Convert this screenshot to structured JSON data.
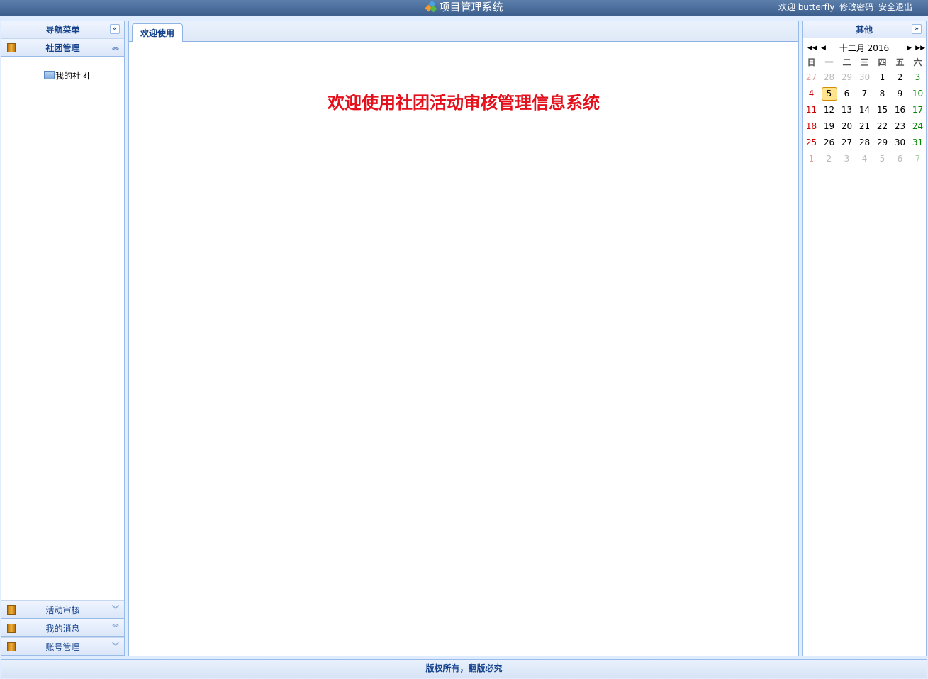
{
  "header": {
    "app_title": "项目管理系统",
    "welcome_user": "欢迎 butterfly",
    "change_password": "修改密码",
    "logout": "安全退出"
  },
  "west": {
    "title": "导航菜单",
    "collapse_icon": "double-chevron-left-icon",
    "active_section": {
      "label": "社团管理",
      "items": [
        {
          "label": "我的社团",
          "icon": "folder-icon"
        }
      ]
    },
    "sections": [
      {
        "label": "活动审核"
      },
      {
        "label": "我的消息"
      },
      {
        "label": "账号管理"
      }
    ]
  },
  "center": {
    "tabs": [
      {
        "label": "欢迎使用"
      }
    ],
    "welcome_text": "欢迎使用社团活动审核管理信息系统",
    "welcome_color": "#e4111c"
  },
  "east": {
    "title": "其他",
    "calendar": {
      "month_year": "十二月 2016",
      "weekdays": [
        "日",
        "一",
        "二",
        "三",
        "四",
        "五",
        "六"
      ],
      "selected_day": "5",
      "weeks": [
        [
          "27",
          "28",
          "29",
          "30",
          "1",
          "2",
          "3"
        ],
        [
          "4",
          "5",
          "6",
          "7",
          "8",
          "9",
          "10"
        ],
        [
          "11",
          "12",
          "13",
          "14",
          "15",
          "16",
          "17"
        ],
        [
          "18",
          "19",
          "20",
          "21",
          "22",
          "23",
          "24"
        ],
        [
          "25",
          "26",
          "27",
          "28",
          "29",
          "30",
          "31"
        ],
        [
          "1",
          "2",
          "3",
          "4",
          "5",
          "6",
          "7"
        ]
      ]
    }
  },
  "footer": {
    "text": "版权所有，翻版必究"
  },
  "colors": {
    "accent": "#15428b",
    "border": "#99bbe8",
    "topbar": "#3d5f8e"
  }
}
